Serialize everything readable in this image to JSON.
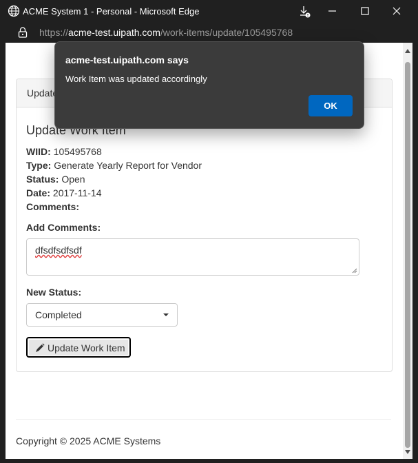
{
  "window": {
    "title": "ACME System 1 - Personal - Microsoft Edge"
  },
  "address": {
    "proto": "https://",
    "host": "acme-test.uipath.com",
    "path": "/work-items/update/105495768"
  },
  "panel": {
    "heading": "Update",
    "title": "Update Work Item",
    "wiid_label": "WIID:",
    "wiid": "105495768",
    "type_label": "Type:",
    "type": "Generate Yearly Report for Vendor",
    "status_label": "Status:",
    "status": "Open",
    "date_label": "Date:",
    "date": "2017-11-14",
    "comments_label": "Comments:",
    "add_comments_label": "Add Comments:",
    "comment_value": "dfsdfsdfsdf",
    "new_status_label": "New Status:",
    "new_status_value": "Completed",
    "update_button": "Update Work Item"
  },
  "footer": {
    "copyright": "Copyright © 2025 ACME Systems"
  },
  "dialog": {
    "title": "acme-test.uipath.com says",
    "message": "Work Item was updated accordingly",
    "ok_label": "OK"
  },
  "colors": {
    "titlebar_bg": "#202020",
    "dialog_bg": "#3b3b3b",
    "ok_button": "#0067c0"
  }
}
